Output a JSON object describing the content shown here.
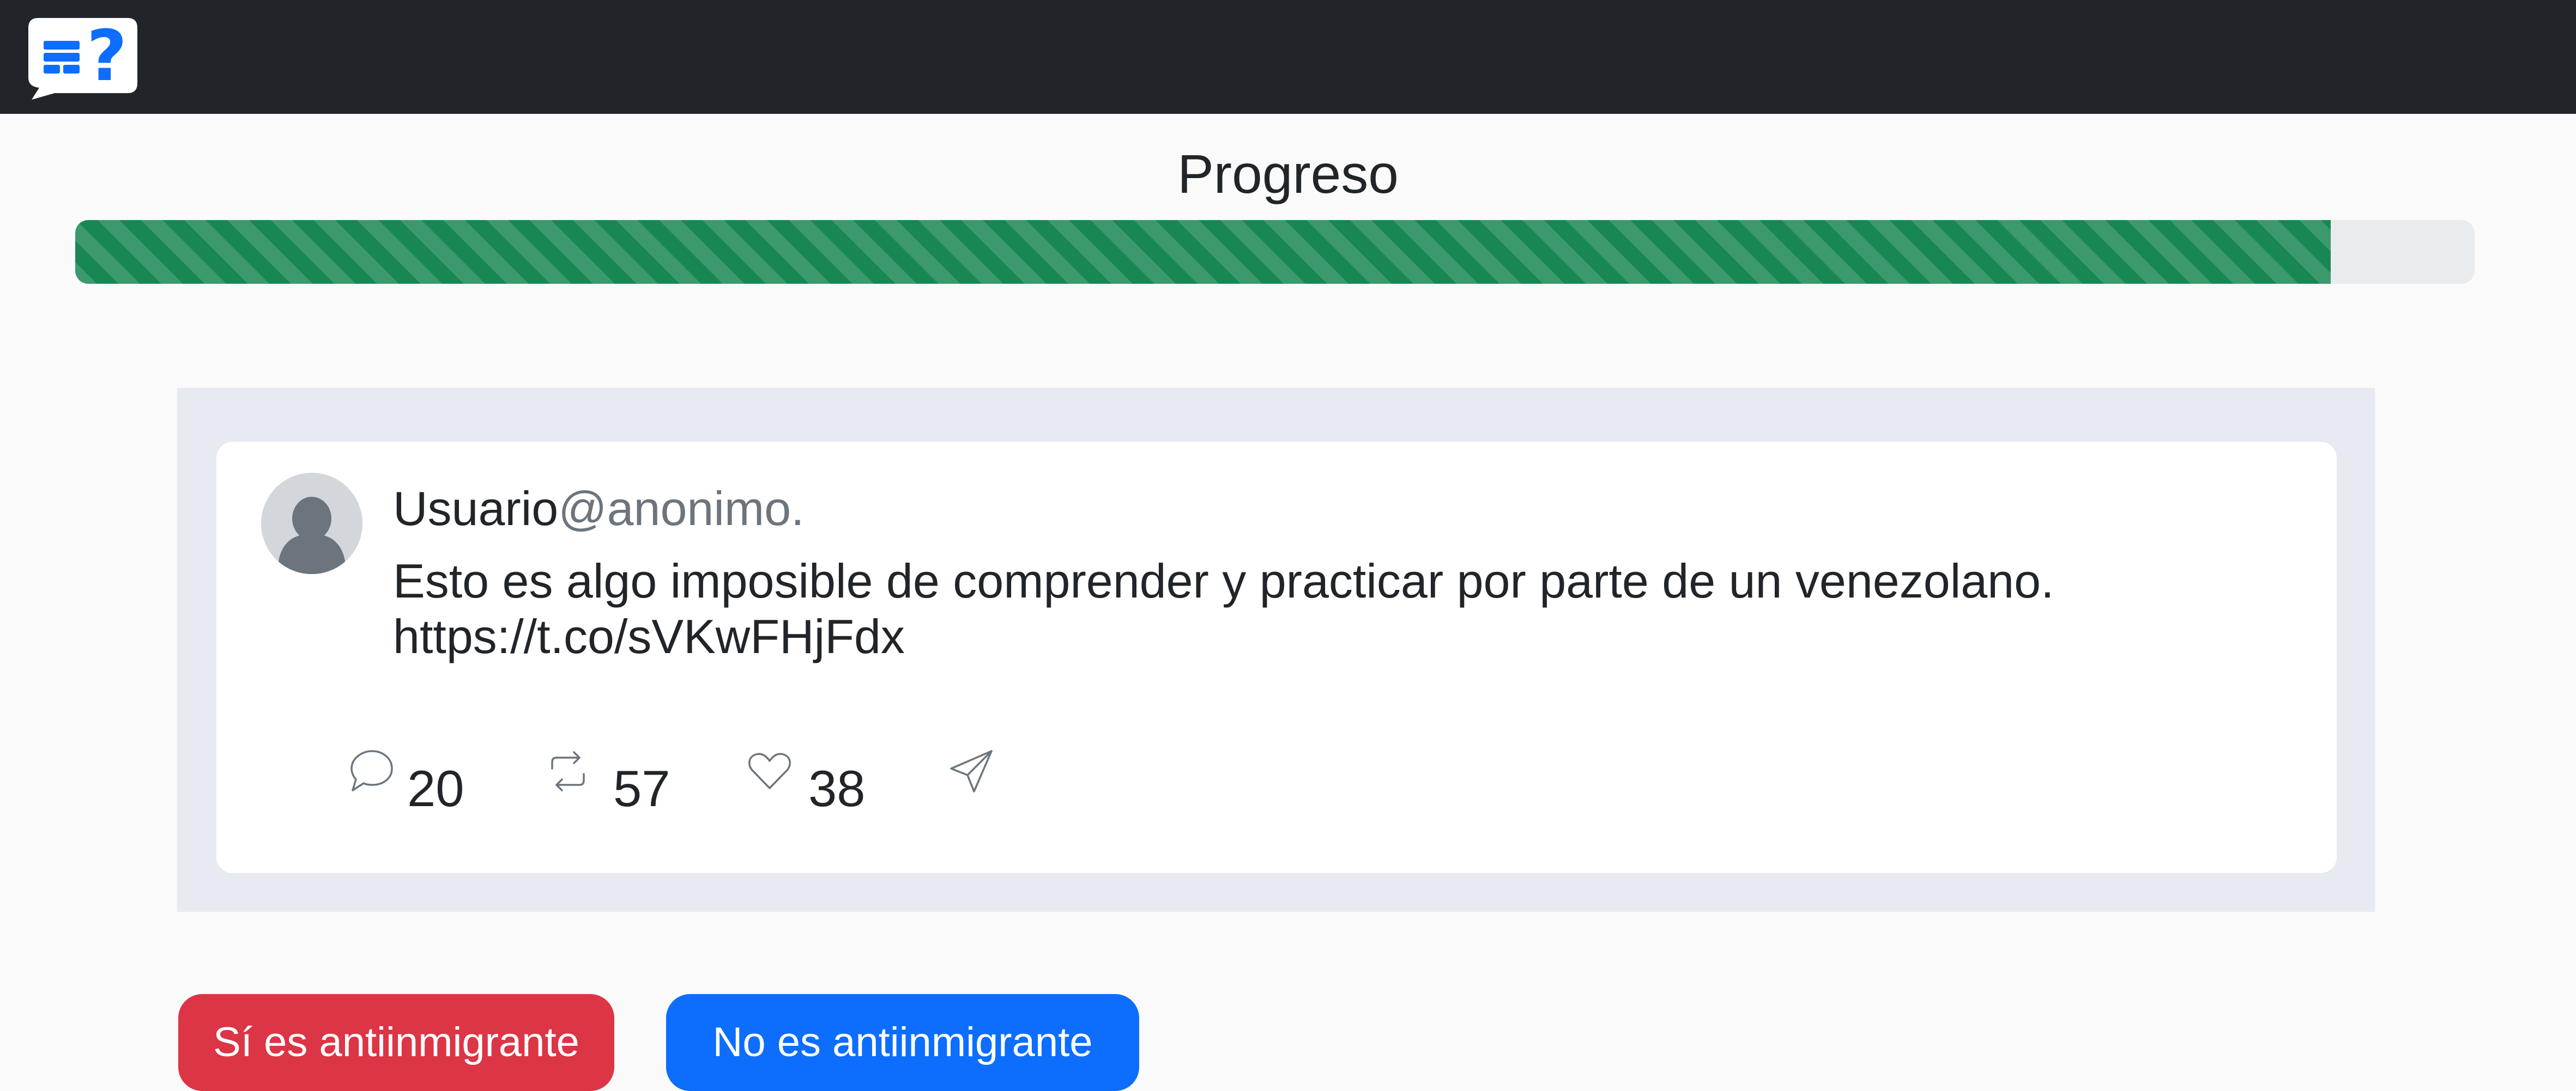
{
  "progress": {
    "title": "Progreso",
    "value_fraction": 0.94,
    "color": "#198754"
  },
  "tweet": {
    "user": "Usuario",
    "handle": "@anonimo.",
    "text": "Esto es algo imposible de comprender y practicar por parte de un venezolano. https://t.co/sVKwFHjFdx",
    "stats": {
      "replies": "20",
      "retweets": "57",
      "likes": "38"
    }
  },
  "buttons": {
    "yes_label": "Sí es antiinmigrante",
    "no_label": "No es antiinmigrante"
  },
  "colors": {
    "navbar": "#212529",
    "yes": "#dc3545",
    "no": "#0d6efd",
    "logo": "#0d6efd"
  },
  "icons": {
    "logo": "chat-question-logo-icon",
    "avatar": "person-avatar-icon",
    "reply": "chat-bubble-icon",
    "retweet": "retweet-icon",
    "like": "heart-icon",
    "share": "send-icon"
  }
}
